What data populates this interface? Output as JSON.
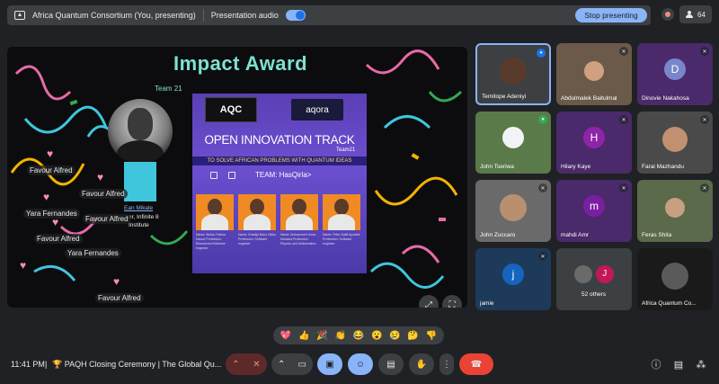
{
  "topbar": {
    "presenting_title": "Africa Quantum Consortium (You, presenting)",
    "audio_label": "Presentation audio",
    "stop_label": "Stop presenting",
    "participant_count": "64"
  },
  "slide": {
    "title": "Impact Award",
    "team_label": "Team 21",
    "person_name": "Ean Mikale",
    "person_role_1": "er, Infinite 8",
    "person_role_2": "Institute",
    "poster": {
      "logo_left": "AQC",
      "logo_right": "aqora",
      "track": "OPEN INNOVATION TRACK",
      "team_small": "Team21",
      "banner": "TO SOLVE AFRICAN PROBLEMS WITH QUANTUM IDEAS",
      "team_name": "TEAM: HasQirla>",
      "bios": [
        "Name: Abdou Fatima Daoud  Profession: Researcher/Software engineer",
        "Name: Khadija Banu Dikko  Profession: Software engineer",
        "Name: Mohammed Umar Musawa  Profession: Physics and Mathematics",
        "Name: Peter Dalili Ayodele  Profession: Software engineer"
      ]
    }
  },
  "reactions": [
    "Favour Alfred",
    "Favour Alfred",
    "Yara Fernandes",
    "Favour Alfred",
    "Favour Alfred",
    "Yara Fernandes",
    "Favour Alfred"
  ],
  "tiles": [
    {
      "name": "Temitope Adeniyi",
      "initial": "",
      "color": "#8a7e6a"
    },
    {
      "name": "Abdulmalek Baitulmal",
      "initial": "",
      "color": "#6b5a4a"
    },
    {
      "name": "Dinovie Nakahosa",
      "initial": "D",
      "color": "#7b1fa2"
    },
    {
      "name": "John Tseriwa",
      "initial": "",
      "color": "#5a7a4a"
    },
    {
      "name": "Hilary Kaye",
      "initial": "H",
      "color": "#8e24aa"
    },
    {
      "name": "Farai Mazhandu",
      "initial": "",
      "color": "#4a4a4a"
    },
    {
      "name": "John Zuccaro",
      "initial": "",
      "color": "#6a6a6a"
    },
    {
      "name": "mahdi Amr",
      "initial": "m",
      "color": "#7b1fa2"
    },
    {
      "name": "Feras Shita",
      "initial": "",
      "color": "#5a6a4a"
    },
    {
      "name": "jamie",
      "initial": "j",
      "color": "#1565c0"
    },
    {
      "name": "52 others",
      "initial": "J",
      "color": "#c2185b"
    },
    {
      "name": "Africa Quantum Co...",
      "initial": "",
      "color": "#1a1a1a"
    }
  ],
  "emoji_bar": [
    "💖",
    "👍",
    "🎉",
    "👏",
    "😂",
    "😮",
    "😢",
    "🤔",
    "👎"
  ],
  "bottom": {
    "time": "11:41 PM",
    "separator": "|",
    "meeting_title": "PAQH Closing Ceremony | The Global Qu..."
  },
  "colors": {
    "accent": "#8ab4f8",
    "end_call": "#ea4335",
    "slide_title": "#7de2cf"
  }
}
